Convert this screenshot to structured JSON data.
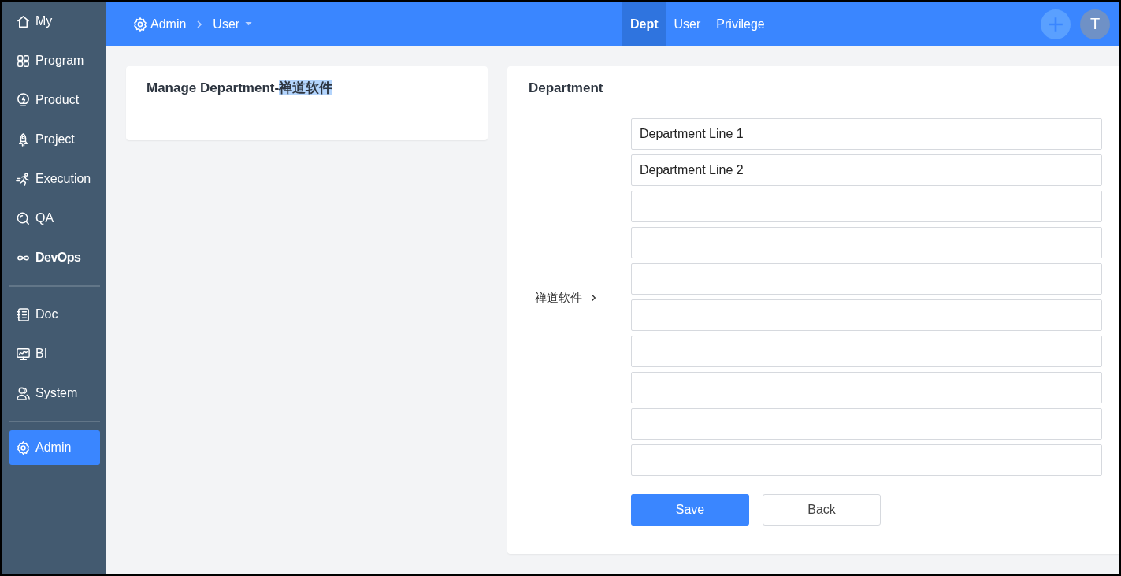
{
  "sidebar": {
    "groups": [
      [
        {
          "label": "My",
          "selected": false,
          "emphasized": false
        },
        {
          "label": "Program",
          "selected": false,
          "emphasized": false
        },
        {
          "label": "Product",
          "selected": false,
          "emphasized": false
        },
        {
          "label": "Project",
          "selected": false,
          "emphasized": false
        },
        {
          "label": "Execution",
          "selected": false,
          "emphasized": false
        },
        {
          "label": "QA",
          "selected": false,
          "emphasized": false
        },
        {
          "label": "DevOps",
          "selected": false,
          "emphasized": true
        }
      ],
      [
        {
          "label": "Doc",
          "selected": false,
          "emphasized": false
        },
        {
          "label": "BI",
          "selected": false,
          "emphasized": false
        },
        {
          "label": "System",
          "selected": false,
          "emphasized": false
        }
      ],
      [
        {
          "label": "Admin",
          "selected": true,
          "emphasized": false
        }
      ]
    ]
  },
  "header": {
    "breadcrumb": {
      "root": "Admin",
      "current": "User"
    },
    "tabs": [
      {
        "label": "Dept",
        "selected": true
      },
      {
        "label": "User",
        "selected": false
      },
      {
        "label": "Privilege",
        "selected": false
      }
    ],
    "avatar": "T"
  },
  "tree_panel": {
    "title_parts": [
      {
        "text": "Manage Department-",
        "selected": false
      },
      {
        "text": "禅道软件",
        "selected": true
      }
    ]
  },
  "form_panel": {
    "title": "Department",
    "parent": "禅道软件",
    "fields": [
      {
        "kind": "text",
        "value": "Department Line 1"
      },
      {
        "kind": "text",
        "value": "Department Line 2"
      },
      {
        "kind": "blank"
      },
      {
        "kind": "blank"
      },
      {
        "kind": "blank"
      },
      {
        "kind": "blank"
      },
      {
        "kind": "blank"
      },
      {
        "kind": "blank"
      },
      {
        "kind": "blank"
      },
      {
        "kind": "blank"
      }
    ],
    "buttons": [
      {
        "label": "Save",
        "kind": "primary"
      },
      {
        "label": "Back",
        "kind": "secondary"
      }
    ]
  }
}
